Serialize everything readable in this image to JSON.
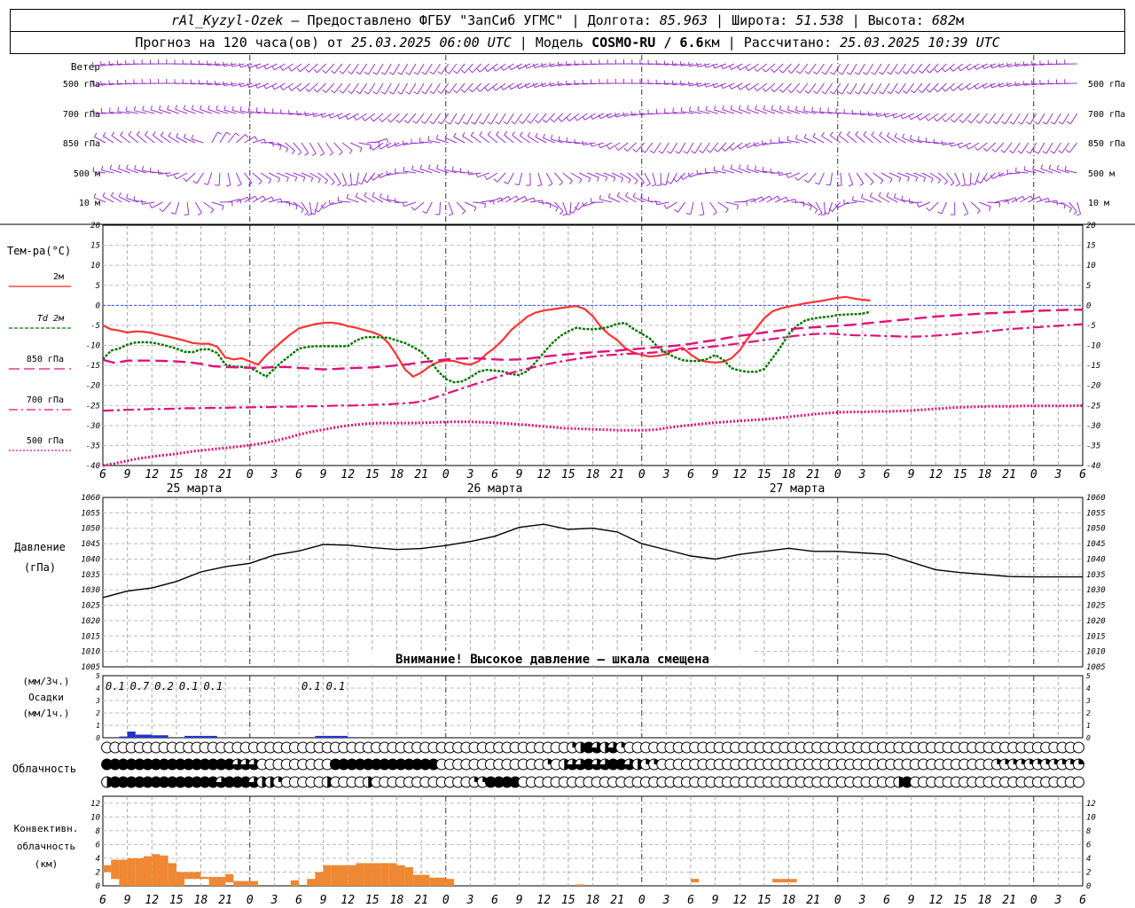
{
  "header": {
    "station": "rAl_Kyzyl-Ozek",
    "provider": "– Предоставлено ФГБУ \"ЗапСиб УГМС\"",
    "lon_label": "Долгота:",
    "lon_value": "85.963",
    "lat_label": "Широта:",
    "lat_value": "51.538",
    "alt_label": "Высота:",
    "alt_value": "682",
    "alt_unit": "м",
    "forecast_label": "Прогноз на 120 часа(ов) от",
    "forecast_time": "25.03.2025 06:00 UTC",
    "model_label": "Модель",
    "model_name": "COSMO-RU / 6.6",
    "model_unit": "км",
    "calc_label": "Рассчитано:",
    "calc_time": "25.03.2025 10:39 UTC"
  },
  "wind_panel": {
    "title": "Ветер",
    "levels": [
      "500 гПа",
      "700 гПа",
      "850 гПа",
      "500 м",
      "10  м"
    ]
  },
  "temp_panel": {
    "title": "Тем-ра(°С)",
    "y_ticks": [
      20,
      15,
      10,
      5,
      0,
      -5,
      -10,
      -15,
      -20,
      -25,
      -30,
      -35,
      -40
    ],
    "legend": [
      {
        "label": "2м",
        "color": "#ff2222",
        "style": "solid"
      },
      {
        "label": "Td  2м",
        "color": "#008800",
        "style": "dashed"
      },
      {
        "label": "850 гПа",
        "color": "#e0107a",
        "style": "longdash"
      },
      {
        "label": "700 гПа",
        "color": "#e0107a",
        "style": "dashdot"
      },
      {
        "label": "500 гПа",
        "color": "#e0107a",
        "style": "dotted"
      }
    ]
  },
  "time_axis": {
    "hour_labels": [
      "6",
      "9",
      "12",
      "15",
      "18",
      "21",
      "0",
      "3",
      "6",
      "9",
      "12",
      "15",
      "18",
      "21",
      "0",
      "3",
      "6",
      "9",
      "12",
      "15",
      "18",
      "21",
      "0",
      "3",
      "6",
      "9",
      "12"
    ],
    "day_labels": [
      "25 марта",
      "26 марта",
      "27 марта"
    ]
  },
  "pressure_panel": {
    "title": "Давление",
    "unit": "(гПа)",
    "y_ticks": [
      1060,
      1055,
      1050,
      1045,
      1040,
      1035,
      1030,
      1025,
      1020,
      1015,
      1010,
      1005
    ],
    "warning": "Внимание! Высокое давление – шкала смещена"
  },
  "precip_panel": {
    "unit_top": "(мм/3ч.)",
    "title": "Осадки",
    "unit_bottom": "(мм/1ч.)",
    "y_ticks": [
      "5",
      "4",
      "3",
      "2",
      "1",
      "0"
    ],
    "amounts": [
      {
        "hour": 9,
        "text": "0.1"
      },
      {
        "hour": 12,
        "text": "0.7"
      },
      {
        "hour": 15,
        "text": "0.2"
      },
      {
        "hour": 18,
        "text": "0.1"
      },
      {
        "hour": 21,
        "text": "0.1"
      },
      {
        "hour": 33,
        "text": "0.1"
      },
      {
        "hour": 36,
        "text": "0.1"
      }
    ]
  },
  "cloud_panel": {
    "title": "Облачность"
  },
  "conv_panel": {
    "title1": "Конвективн.",
    "title2": "облачность",
    "unit": "(км)",
    "y_ticks": [
      12,
      10,
      8,
      6,
      4,
      2,
      0
    ]
  },
  "colors": {
    "wind": "#9a32cd",
    "t2m": "#ff3333",
    "td": "#007700",
    "upper": "#e0107a",
    "precip": "#2233cc",
    "conv": "#ee8833",
    "zero_line": "#3355ff"
  },
  "chart_data": [
    {
      "type": "line",
      "title": "Тем-ра(°С)",
      "x": [
        6,
        7,
        8,
        9,
        10,
        11,
        12,
        13,
        14,
        15,
        16,
        17,
        18,
        19,
        20,
        21,
        22,
        23,
        24,
        25,
        26,
        27,
        28,
        29,
        30,
        31,
        32,
        33,
        34,
        35,
        36,
        37,
        38,
        39,
        40,
        41,
        42,
        43,
        44,
        45,
        46,
        47,
        48,
        49,
        50,
        51,
        52,
        53,
        54,
        55,
        56,
        57,
        58,
        59,
        60,
        61,
        62,
        63,
        64,
        65,
        66,
        67,
        68,
        69,
        70,
        71,
        72,
        73,
        74,
        75,
        76,
        77,
        78,
        79,
        80,
        81,
        82,
        83,
        84,
        85,
        86,
        87,
        88,
        89,
        90,
        91,
        92,
        93,
        94,
        95,
        96,
        97,
        98,
        99,
        100,
        101,
        102,
        103,
        104,
        105,
        106,
        107,
        108,
        109,
        110,
        111,
        112,
        113,
        114,
        115,
        116,
        117,
        118,
        119,
        120,
        121,
        122,
        123,
        124,
        125,
        126
      ],
      "ylim": [
        -40,
        20
      ],
      "series": [
        {
          "name": "2м",
          "values": [
            -5,
            -6,
            -6.3,
            -6.8,
            -6.5,
            -6.6,
            -6.9,
            -7.4,
            -7.8,
            -8.3,
            -8.8,
            -9.4,
            -9.6,
            -9.6,
            -10.3,
            -13,
            -13.5,
            -13.2,
            -14,
            -14.8,
            -12.5,
            -10.7,
            -8.9,
            -7.2,
            -5.8,
            -5.2,
            -4.7,
            -4.4,
            -4.3,
            -4.6,
            -5.2,
            -5.6,
            -6.2,
            -6.7,
            -7.5,
            -9.5,
            -12.5,
            -16,
            -17.8,
            -16.8,
            -15.3,
            -14.2,
            -13.8,
            -13.9,
            -14.5,
            -14.8,
            -14,
            -12.1,
            -10.6,
            -8.6,
            -6.2,
            -4.5,
            -2.8,
            -1.8,
            -1.3,
            -1,
            -0.7,
            -0.4,
            -0.2,
            -0.9,
            -2.7,
            -5.4,
            -7.3,
            -8.7,
            -10.7,
            -11.8,
            -12.4,
            -12.8,
            -12.6,
            -12.2,
            -11.2,
            -10.6,
            -12.3,
            -13.6,
            -14.1,
            -14.3,
            -14.1,
            -13.2,
            -11.2,
            -8.2,
            -5.8,
            -3.2,
            -1.5,
            -0.8,
            -0.3,
            0.1,
            0.5,
            0.8,
            1.1,
            1.5,
            1.9,
            2.1,
            1.7,
            1.4,
            1.2
          ]
        },
        {
          "name": "Td  2м",
          "values": [
            -13.5,
            -11.3,
            -10.8,
            -9.8,
            -9.3,
            -9.2,
            -9.3,
            -9.7,
            -10.2,
            -10.8,
            -11.6,
            -11.7,
            -11,
            -11,
            -11.9,
            -14.8,
            -15.3,
            -15.4,
            -15.6,
            -16.6,
            -17.8,
            -15.8,
            -14,
            -12.4,
            -10.8,
            -10.4,
            -10.2,
            -10.2,
            -10.2,
            -10.2,
            -10.2,
            -8.8,
            -8,
            -7.9,
            -8,
            -8.1,
            -8.8,
            -9.4,
            -10.4,
            -11.6,
            -13.6,
            -16.3,
            -18.4,
            -19.2,
            -19,
            -18,
            -16.6,
            -16.1,
            -16.3,
            -16.5,
            -17.2,
            -17.4,
            -16.4,
            -14.2,
            -11.8,
            -9.5,
            -7.7,
            -6.5,
            -5.6,
            -5.9,
            -6,
            -5.8,
            -5.4,
            -4.6,
            -4.4,
            -5.9,
            -7.1,
            -8.3,
            -10.5,
            -11.9,
            -12.9,
            -13.7,
            -13.9,
            -13.9,
            -13.4,
            -12.4,
            -13.6,
            -15.7,
            -16.3,
            -16.6,
            -16.6,
            -15.9,
            -13.2,
            -10.4,
            -7.2,
            -5.1,
            -3.8,
            -3.3,
            -3,
            -2.8,
            -2.4,
            -2.3,
            -2.2,
            -2.1,
            -1.6
          ]
        },
        {
          "name": "850 гПа",
          "values": [
            -13.6,
            -14.4,
            -13.8,
            -13.8,
            -13.8,
            -13.9,
            -14,
            -14.2,
            -14.6,
            -15.2,
            -15.4,
            -15.5,
            -15.6,
            -15.6,
            -15.4,
            -15.4,
            -15.6,
            -15.8,
            -16,
            -15.9,
            -15.7,
            -15.6,
            -15.5,
            -15.3,
            -15,
            -14.7,
            -14.2,
            -13.9,
            -13.5,
            -13.3,
            -13.2,
            -13.3,
            -13.5,
            -13.6,
            -13.5,
            -13.2,
            -12.8,
            -12.5,
            -12.2,
            -12,
            -11.7,
            -11.5,
            -11.3,
            -11,
            -10.8,
            -10.5,
            -10.3,
            -10,
            -9.6,
            -9.1,
            -8.7,
            -8.1,
            -7.6,
            -7.2,
            -6.8,
            -6.4,
            -6,
            -5.7,
            -5.5,
            -5.3,
            -5.1,
            -4.9,
            -4.6,
            -4.3,
            -4,
            -3.7,
            -3.4,
            -3.1,
            -2.8,
            -2.6,
            -2.4,
            -2.2,
            -2,
            -1.9,
            -1.7,
            -1.6,
            -1.4,
            -1.3,
            -1.2,
            -1.1,
            -1.1
          ]
        },
        {
          "name": "700 гПа",
          "values": [
            -26.3,
            -26.2,
            -26.1,
            -26,
            -25.9,
            -25.9,
            -25.8,
            -25.7,
            -25.7,
            -25.6,
            -25.6,
            -25.5,
            -25.5,
            -25.4,
            -25.4,
            -25.3,
            -25.3,
            -25.2,
            -25.2,
            -25.1,
            -25,
            -25,
            -24.9,
            -24.8,
            -24.7,
            -24.5,
            -24.3,
            -23.8,
            -22.8,
            -21.8,
            -20.8,
            -19.8,
            -18.9,
            -17.9,
            -17,
            -16.2,
            -15.5,
            -14.8,
            -14.2,
            -13.7,
            -13.2,
            -12.8,
            -12.5,
            -12.3,
            -12.1,
            -12,
            -11.8,
            -11.5,
            -11.2,
            -10.9,
            -10.6,
            -10.3,
            -10,
            -9.6,
            -9.2,
            -8.8,
            -8.4,
            -8,
            -7.6,
            -7.3,
            -7.1,
            -7.1,
            -7.3,
            -7.5,
            -7.5,
            -7.6,
            -7.7,
            -7.8,
            -7.8,
            -7.7,
            -7.5,
            -7.3,
            -7,
            -6.8,
            -6.5,
            -6.2,
            -5.9,
            -5.7,
            -5.5,
            -5.3,
            -5.1,
            -4.9,
            -4.7
          ]
        },
        {
          "name": "500 гПа",
          "values": [
            -40,
            -39.5,
            -38.9,
            -38.3,
            -37.9,
            -37.5,
            -37.2,
            -36.8,
            -36.4,
            -36.1,
            -35.8,
            -35.5,
            -35.2,
            -34.8,
            -34.4,
            -33.8,
            -33.1,
            -32.3,
            -31.6,
            -31.1,
            -30.6,
            -30.1,
            -29.8,
            -29.5,
            -29.4,
            -29.4,
            -29.4,
            -29.4,
            -29.3,
            -29.2,
            -29.1,
            -29.1,
            -29.1,
            -29.2,
            -29.3,
            -29.5,
            -29.7,
            -29.9,
            -30.2,
            -30.4,
            -30.7,
            -30.8,
            -30.9,
            -31,
            -31.1,
            -31.2,
            -31.2,
            -31.2,
            -31,
            -30.6,
            -30.2,
            -29.9,
            -29.6,
            -29.3,
            -29.1,
            -28.9,
            -28.7,
            -28.5,
            -28.3,
            -28,
            -27.7,
            -27.4,
            -27.1,
            -26.9,
            -26.7,
            -26.6,
            -26.6,
            -26.5,
            -26.5,
            -26.4,
            -26.3,
            -26.1,
            -25.9,
            -25.7,
            -25.5,
            -25.4,
            -25.3,
            -25.2,
            -25.2,
            -25.2,
            -25.1,
            -25.1,
            -25.1,
            -25.1,
            -25.1,
            -25
          ]
        }
      ]
    },
    {
      "type": "line",
      "title": "Давление",
      "ylabel": "(гПа)",
      "ylim": [
        1005,
        1060
      ],
      "x": [
        6,
        9,
        12,
        15,
        18,
        21,
        24,
        27,
        30,
        33,
        36,
        39,
        42,
        45,
        48,
        51,
        54,
        57,
        60,
        63,
        66,
        69,
        72,
        75,
        78,
        81,
        84,
        87,
        90,
        93,
        96,
        99,
        102,
        105,
        108,
        111,
        114,
        117,
        120,
        123,
        126
      ],
      "series": [
        {
          "name": "Давление",
          "values": [
            1027.5,
            1029.6,
            1030.6,
            1032.7,
            1035.8,
            1037.5,
            1038.6,
            1041.3,
            1042.6,
            1044.7,
            1044.5,
            1043.7,
            1043.1,
            1043.4,
            1044.4,
            1045.7,
            1047.4,
            1050.3,
            1051.3,
            1049.6,
            1050,
            1048.8,
            1045,
            1043,
            1041,
            1040,
            1041.5,
            1042.5,
            1043.5,
            1042.5,
            1042.5,
            1042,
            1041.5,
            1039,
            1036.5,
            1035.6,
            1035,
            1034.3,
            1034.2,
            1034.2,
            1034.2
          ]
        }
      ]
    },
    {
      "type": "bar",
      "title": "Осадки",
      "ylabel": "(мм/1ч.)",
      "ylim": [
        0,
        5
      ],
      "x": [
        9,
        10,
        11,
        12,
        13,
        14,
        15,
        16,
        17,
        18,
        19,
        20,
        21,
        22,
        23,
        24,
        25,
        26,
        27,
        28,
        29,
        30,
        31,
        32,
        33,
        34,
        35,
        36,
        37,
        38,
        39,
        40,
        41
      ],
      "series": [
        {
          "name": "мм/1ч.",
          "values": [
            0.1,
            0.5,
            0.25,
            0.25,
            0.2,
            0.2,
            0,
            0,
            0.15,
            0.15,
            0.15,
            0.15,
            0,
            0,
            0,
            0,
            0,
            0,
            0,
            0,
            0,
            0,
            0,
            0,
            0.15,
            0.15,
            0.15,
            0.15,
            0.05,
            0,
            0,
            0,
            0
          ]
        }
      ]
    },
    {
      "type": "bar",
      "title": "Конвективн. облачность",
      "ylabel": "(км)",
      "ylim": [
        0,
        13
      ],
      "x": [
        6,
        7,
        8,
        9,
        10,
        11,
        12,
        13,
        14,
        15,
        16,
        17,
        18,
        19,
        20,
        21,
        22,
        23,
        24,
        25,
        26,
        27,
        28,
        29,
        30,
        31,
        32,
        33,
        34,
        35,
        36,
        37,
        38,
        39,
        40,
        41,
        42,
        43,
        44,
        45,
        46,
        47,
        48,
        49,
        50,
        51,
        52,
        53,
        54,
        55,
        56,
        57,
        58,
        59,
        60,
        61,
        62
      ],
      "series": [
        {
          "name": "base",
          "values": [
            2,
            1,
            0,
            0,
            0,
            0,
            0,
            0,
            0,
            0,
            1,
            1,
            1,
            0,
            0,
            0.5,
            0,
            0,
            0,
            0,
            0,
            0,
            0,
            0,
            0,
            0,
            0,
            0,
            0,
            0,
            0,
            0,
            0,
            0,
            0,
            0,
            0,
            0,
            0,
            0,
            0,
            0,
            0,
            0,
            0,
            0,
            0,
            0,
            0,
            0,
            0,
            0,
            0,
            0,
            0,
            0,
            0
          ]
        },
        {
          "name": "top",
          "values": [
            3,
            3.8,
            3.8,
            4,
            4,
            4.3,
            4.6,
            4.4,
            3.3,
            2,
            2,
            2,
            1.3,
            1.3,
            1.3,
            1.7,
            0.7,
            0.7,
            0.7,
            0,
            0,
            0,
            0,
            0.8,
            0,
            1,
            2,
            3,
            3,
            3,
            3,
            3.3,
            3.3,
            3.3,
            3.3,
            3.3,
            3,
            2.7,
            1.6,
            1.6,
            1.2,
            1.2,
            1,
            0,
            0,
            0,
            0,
            0,
            0,
            0,
            0,
            0,
            0,
            0,
            0,
            0,
            0
          ]
        }
      ]
    }
  ]
}
